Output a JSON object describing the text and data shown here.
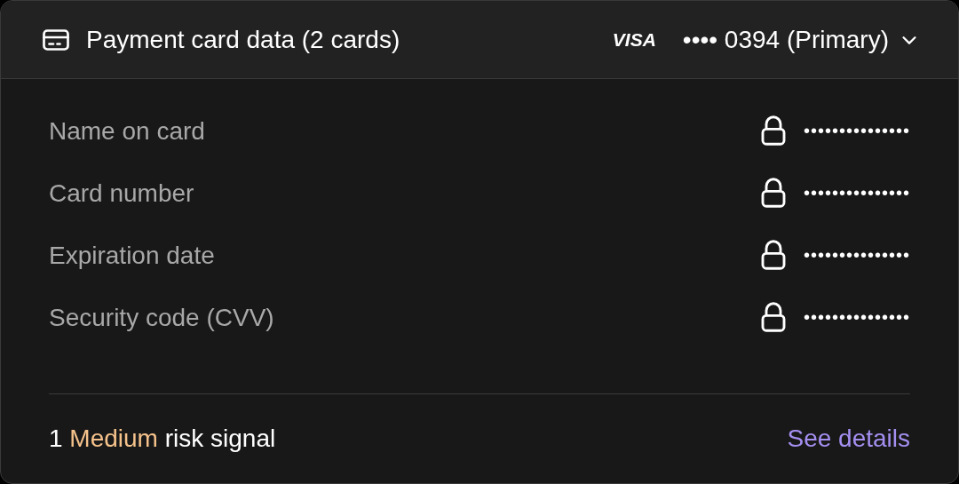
{
  "header": {
    "title": "Payment card data (2 cards)",
    "brand": "VISA",
    "masked_number": "•••• 0394 (Primary)",
    "expanded": false
  },
  "fields": [
    {
      "label": "Name on card",
      "locked": true,
      "value": "•••••••••••••••"
    },
    {
      "label": "Card number",
      "locked": true,
      "value": "•••••••••••••••"
    },
    {
      "label": "Expiration date",
      "locked": true,
      "value": "•••••••••••••••"
    },
    {
      "label": "Security code (CVV)",
      "locked": true,
      "value": "•••••••••••••••"
    }
  ],
  "footer": {
    "count": "1",
    "severity": "Medium",
    "text": "risk signal",
    "link": "See details"
  }
}
